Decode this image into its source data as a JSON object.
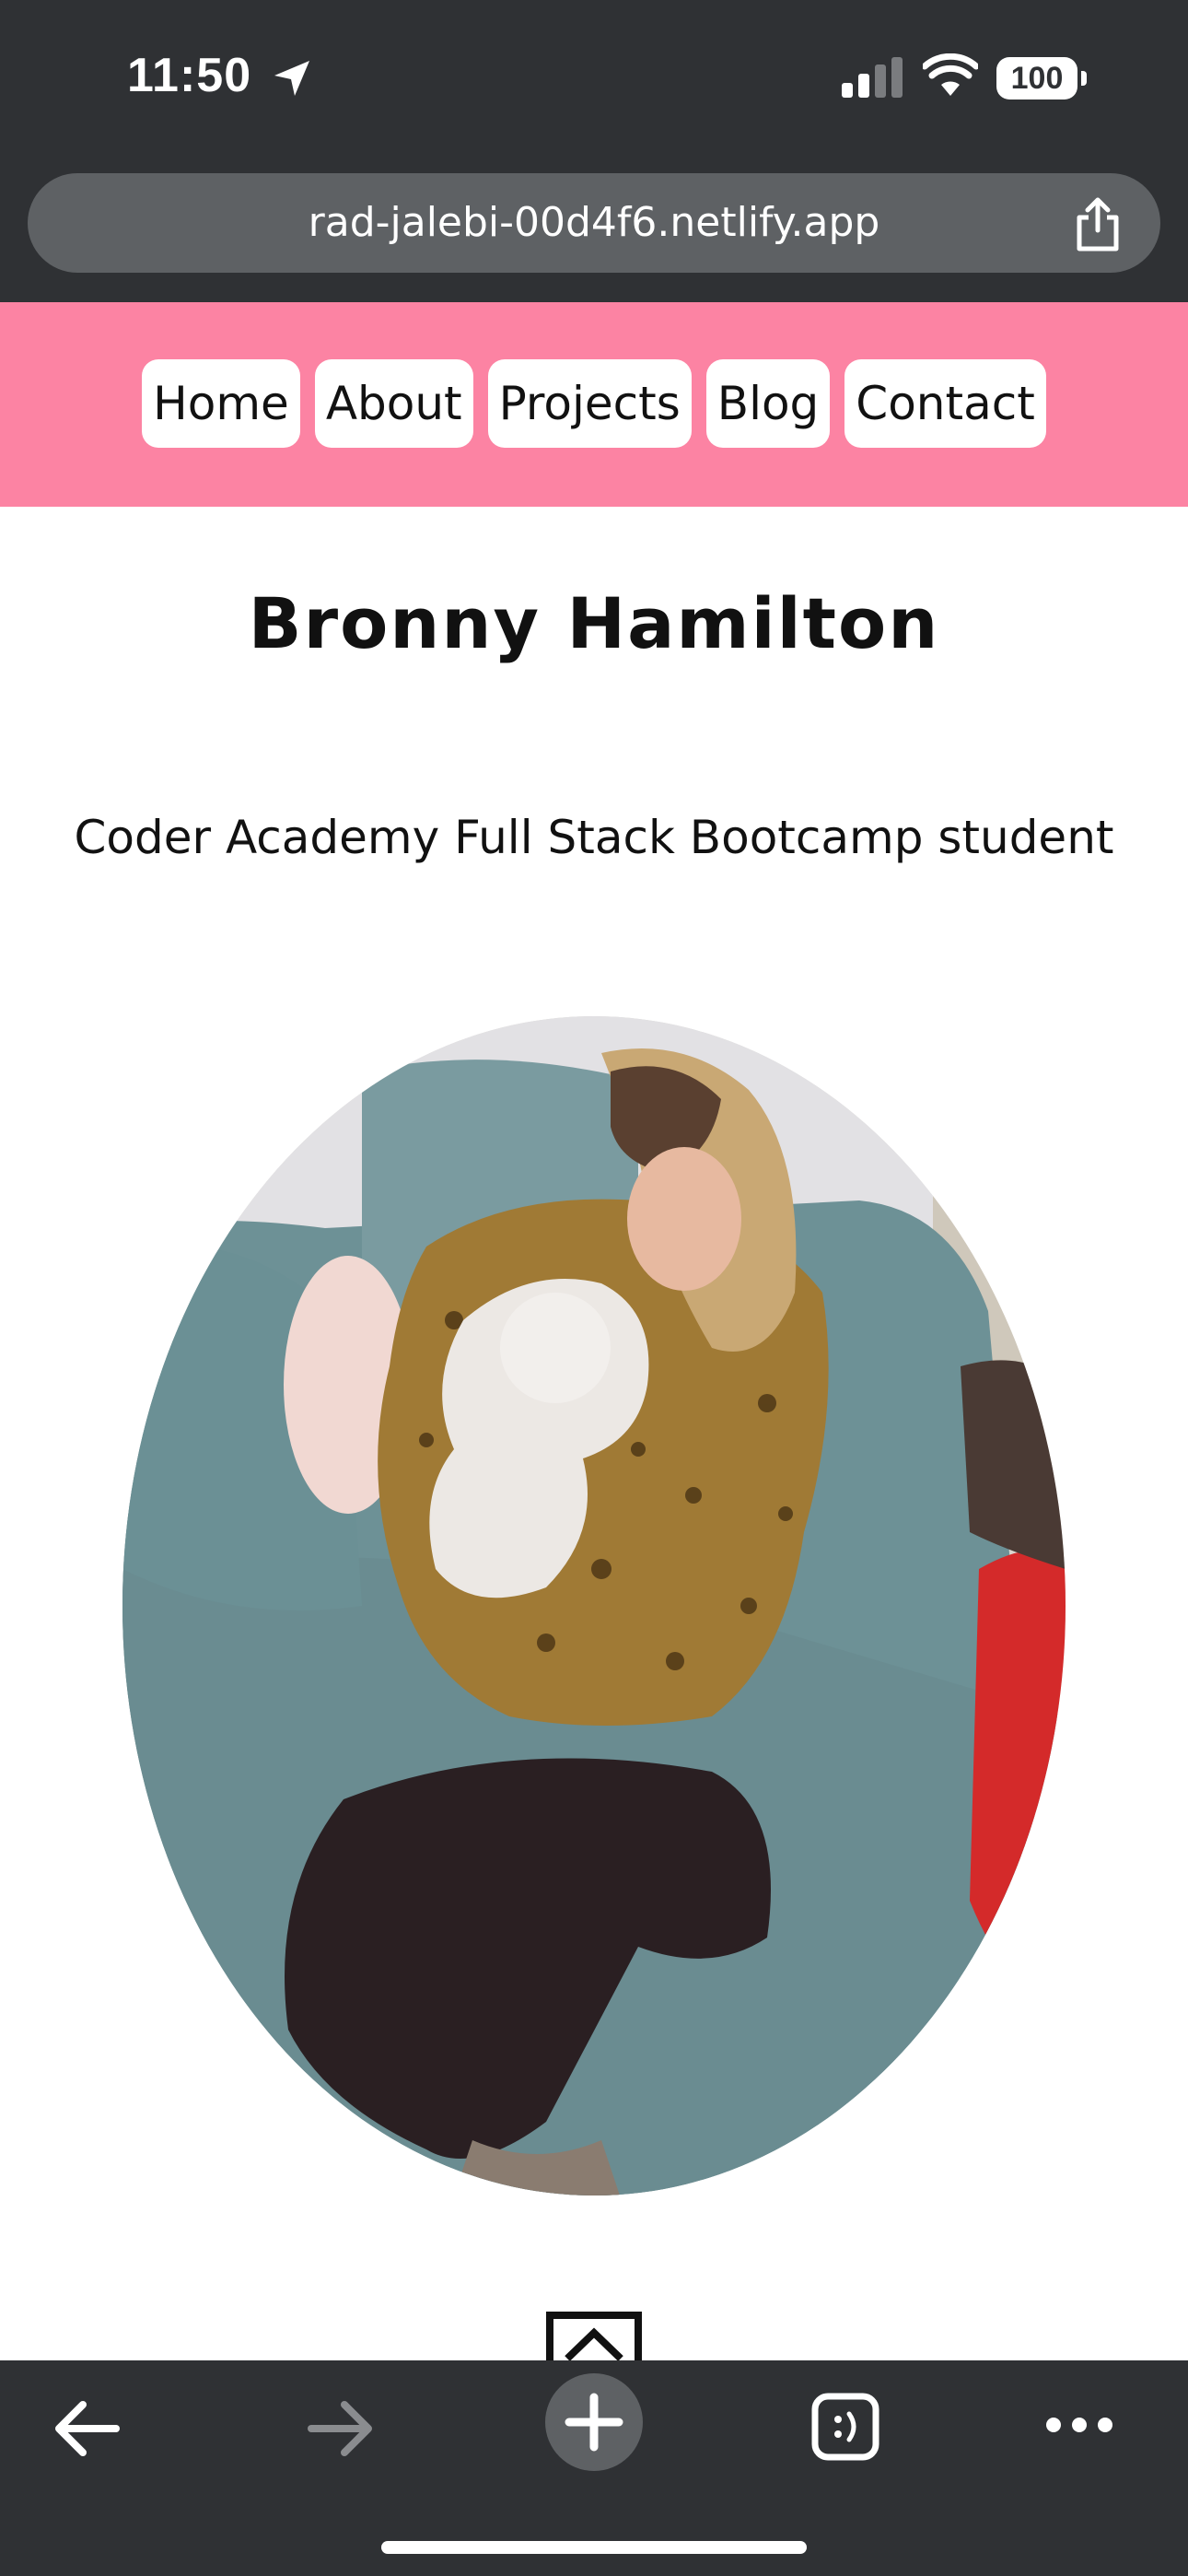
{
  "status_bar": {
    "time": "11:50",
    "battery": "100"
  },
  "browser": {
    "url": "rad-jalebi-00d4f6.netlify.app"
  },
  "nav": {
    "items": [
      {
        "label": "Home"
      },
      {
        "label": "About"
      },
      {
        "label": "Projects"
      },
      {
        "label": "Blog"
      },
      {
        "label": "Contact"
      }
    ]
  },
  "main": {
    "title": "Bronny Hamilton",
    "subtitle": "Coder Academy Full Stack Bootcamp student"
  },
  "colors": {
    "nav_background": "#fc83a3",
    "chrome_background": "#2f3134",
    "address_bar": "#5e6164"
  },
  "icons": {
    "status": [
      "location-arrow-icon",
      "cellular-signal-icon",
      "wifi-icon",
      "battery-icon"
    ],
    "address_bar": [
      "share-icon"
    ],
    "toolbar": [
      "back-arrow-icon",
      "forward-arrow-icon",
      "new-tab-plus-icon",
      "tabs-icon",
      "more-menu-icon"
    ],
    "page": [
      "scroll-to-top-icon"
    ]
  }
}
